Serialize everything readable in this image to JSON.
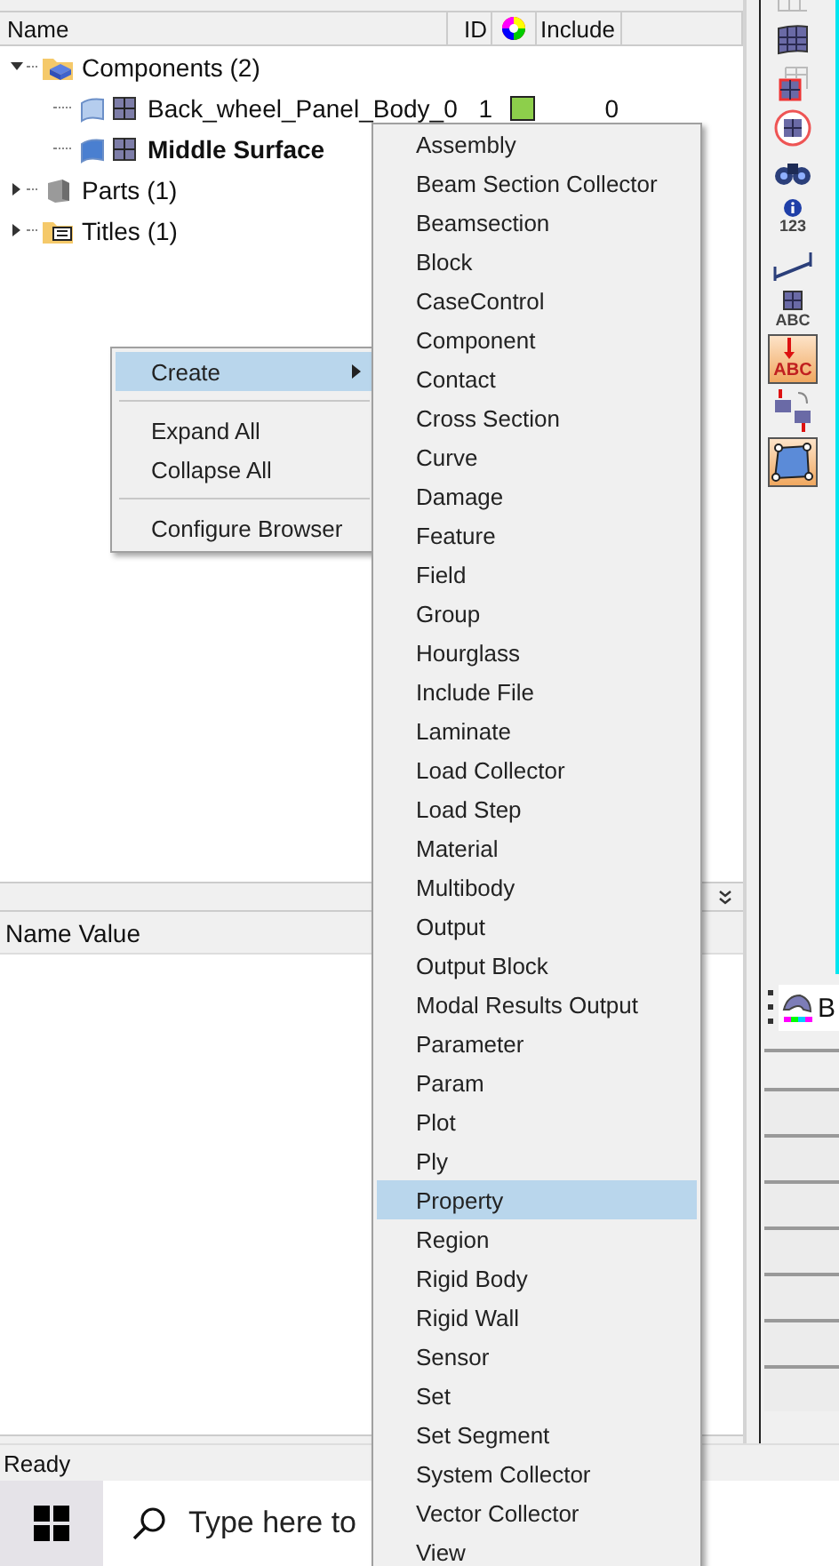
{
  "browser": {
    "columns": [
      {
        "kind": "text",
        "label": "Name"
      },
      {
        "kind": "text",
        "label": "ID"
      },
      {
        "kind": "color"
      },
      {
        "kind": "text",
        "label": "Include"
      }
    ],
    "tree": [
      {
        "label": "Components (2)",
        "kind": "component-folder",
        "expanded": true,
        "children": [
          {
            "label": "Back_wheel_Panel_Body_0",
            "current": false,
            "id": "1",
            "color": "#8dcf4b",
            "include": "0"
          },
          {
            "label": "Middle Surface",
            "current": true
          }
        ]
      },
      {
        "label": "Parts (1)",
        "kind": "part",
        "expanded": false
      },
      {
        "label": "Titles (1)",
        "kind": "title-folder",
        "expanded": false
      }
    ]
  },
  "properties_panel": {
    "header": "Name Value"
  },
  "context_menu": {
    "items": [
      {
        "kind": "item",
        "label": "Create",
        "selected": true,
        "submenu": true
      },
      {
        "kind": "separator"
      },
      {
        "kind": "item",
        "label": "Expand All",
        "selected": false,
        "submenu": false
      },
      {
        "kind": "item",
        "label": "Collapse All",
        "selected": false,
        "submenu": false
      },
      {
        "kind": "separator"
      },
      {
        "kind": "item",
        "label": "Configure Browser",
        "selected": false,
        "submenu": false
      }
    ]
  },
  "submenu": {
    "items": [
      {
        "label": "Assembly",
        "selected": false
      },
      {
        "label": "Beam Section Collector",
        "selected": false
      },
      {
        "label": "Beamsection",
        "selected": false
      },
      {
        "label": "Block",
        "selected": false
      },
      {
        "label": "CaseControl",
        "selected": false
      },
      {
        "label": "Component",
        "selected": false
      },
      {
        "label": "Contact",
        "selected": false
      },
      {
        "label": "Cross Section",
        "selected": false
      },
      {
        "label": "Curve",
        "selected": false
      },
      {
        "label": "Damage",
        "selected": false
      },
      {
        "label": "Feature",
        "selected": false
      },
      {
        "label": "Field",
        "selected": false
      },
      {
        "label": "Group",
        "selected": false
      },
      {
        "label": "Hourglass",
        "selected": false
      },
      {
        "label": "Include File",
        "selected": false
      },
      {
        "label": "Laminate",
        "selected": false
      },
      {
        "label": "Load Collector",
        "selected": false
      },
      {
        "label": "Load Step",
        "selected": false
      },
      {
        "label": "Material",
        "selected": false
      },
      {
        "label": "Multibody",
        "selected": false
      },
      {
        "label": "Output",
        "selected": false
      },
      {
        "label": "Output Block",
        "selected": false
      },
      {
        "label": "Modal Results Output",
        "selected": false
      },
      {
        "label": "Parameter",
        "selected": false
      },
      {
        "label": "Param",
        "selected": false
      },
      {
        "label": "Plot",
        "selected": false
      },
      {
        "label": "Ply",
        "selected": false
      },
      {
        "label": "Property",
        "selected": true
      },
      {
        "label": "Region",
        "selected": false
      },
      {
        "label": "Rigid Body",
        "selected": false
      },
      {
        "label": "Rigid Wall",
        "selected": false
      },
      {
        "label": "Sensor",
        "selected": false
      },
      {
        "label": "Set",
        "selected": false
      },
      {
        "label": "Set Segment",
        "selected": false
      },
      {
        "label": "System Collector",
        "selected": false
      },
      {
        "label": "Vector Collector",
        "selected": false
      },
      {
        "label": "View",
        "selected": false
      }
    ]
  },
  "toolbar": [
    {
      "kind": "mesh-partial",
      "active": false
    },
    {
      "kind": "mesh",
      "active": false
    },
    {
      "kind": "mesh-box",
      "active": false
    },
    {
      "kind": "mesh-circle",
      "active": false
    },
    {
      "kind": "binoculars",
      "active": false
    },
    {
      "kind": "info",
      "active": false,
      "label": "123"
    },
    {
      "kind": "scale",
      "active": false
    },
    {
      "kind": "mesh-label",
      "active": false,
      "label": "ABC"
    },
    {
      "kind": "pin-label",
      "active": true,
      "label": "ABC"
    },
    {
      "kind": "swap",
      "active": false
    },
    {
      "kind": "quad",
      "active": true
    }
  ],
  "side_panel": {
    "label": "B"
  },
  "status_bar": "Ready",
  "taskbar": {
    "search": {
      "placeholder": "Type here to"
    }
  }
}
